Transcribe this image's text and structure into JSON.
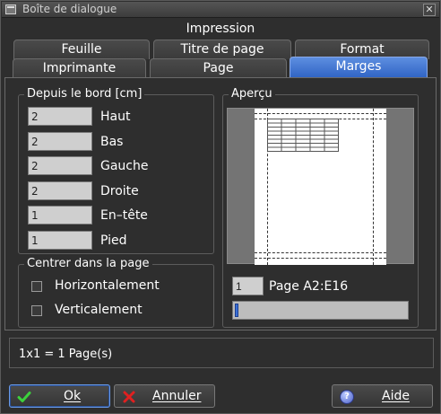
{
  "window": {
    "title": "Boîte de dialogue",
    "close_glyph": "✕"
  },
  "dialog": {
    "title": "Impression"
  },
  "tabs_row1": [
    "Feuille",
    "Titre de page",
    "Format"
  ],
  "tabs_row2": [
    "Imprimante",
    "Page",
    "Marges"
  ],
  "active_tab": "Marges",
  "margins": {
    "group_title": "Depuis le bord [cm]",
    "fields": [
      {
        "label": "Haut",
        "value": "2"
      },
      {
        "label": "Bas",
        "value": "2"
      },
      {
        "label": "Gauche",
        "value": "2"
      },
      {
        "label": "Droite",
        "value": "2"
      },
      {
        "label": "En–tête",
        "value": "1"
      },
      {
        "label": "Pied",
        "value": "1"
      }
    ]
  },
  "center": {
    "group_title": "Centrer dans la page",
    "horizontal_label": "Horizontalement",
    "vertical_label": "Verticalement"
  },
  "preview": {
    "group_title": "Aperçu",
    "page_number": "1",
    "page_range_label": "Page A2:E16"
  },
  "status": {
    "text": "1x1 = 1 Page(s)"
  },
  "buttons": {
    "ok": "Ok",
    "cancel": "Annuler",
    "help": "Aide"
  },
  "colors": {
    "accent": "#3a6fd6",
    "ok_icon": "#3cd23c",
    "cancel_icon": "#e02020",
    "help_icon": "#4a5fc7"
  }
}
